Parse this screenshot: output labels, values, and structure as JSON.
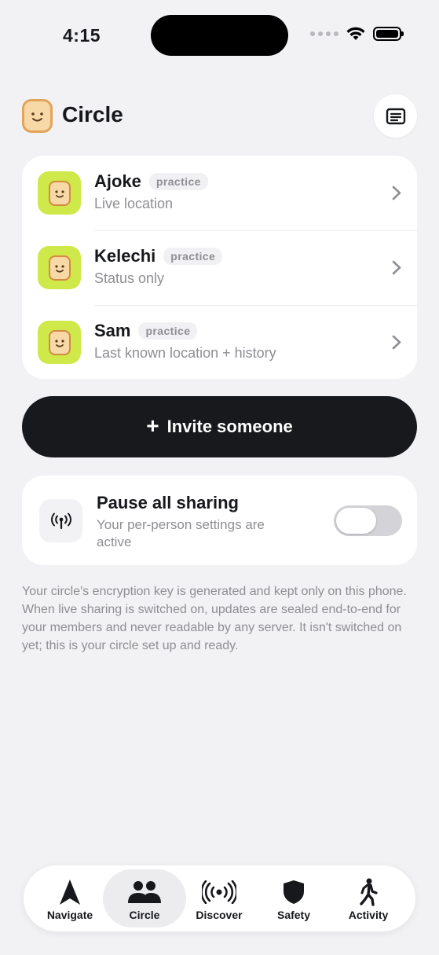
{
  "status_bar": {
    "time": "4:15"
  },
  "header": {
    "title": "Circle",
    "list_button_icon": "list-icon"
  },
  "members": [
    {
      "name": "Ajoke",
      "badge": "practice",
      "status": "Live location"
    },
    {
      "name": "Kelechi",
      "badge": "practice",
      "status": "Status only"
    },
    {
      "name": "Sam",
      "badge": "practice",
      "status": "Last known location + history"
    }
  ],
  "invite": {
    "plus": "+",
    "label": "Invite someone"
  },
  "pause": {
    "title": "Pause all sharing",
    "subtitle": "Your per-person settings are active",
    "toggle_on": false
  },
  "footnote": "Your circle's encryption key is generated and kept only on this phone. When live sharing is switched on, updates are sealed end-to-end for your members and never readable by any server. It isn't switched on yet; this is your circle set up and ready.",
  "tabs": [
    {
      "label": "Navigate",
      "icon": "navigate-arrow-icon",
      "active": false
    },
    {
      "label": "Circle",
      "icon": "people-icon",
      "active": true
    },
    {
      "label": "Discover",
      "icon": "broadcast-icon",
      "active": false
    },
    {
      "label": "Safety",
      "icon": "shield-icon",
      "active": false
    },
    {
      "label": "Activity",
      "icon": "walking-icon",
      "active": false
    }
  ],
  "colors": {
    "background": "#f2f2f4",
    "avatar": "#cfe84a",
    "invite_button": "#18191c",
    "muted_text": "#8e8e93"
  }
}
